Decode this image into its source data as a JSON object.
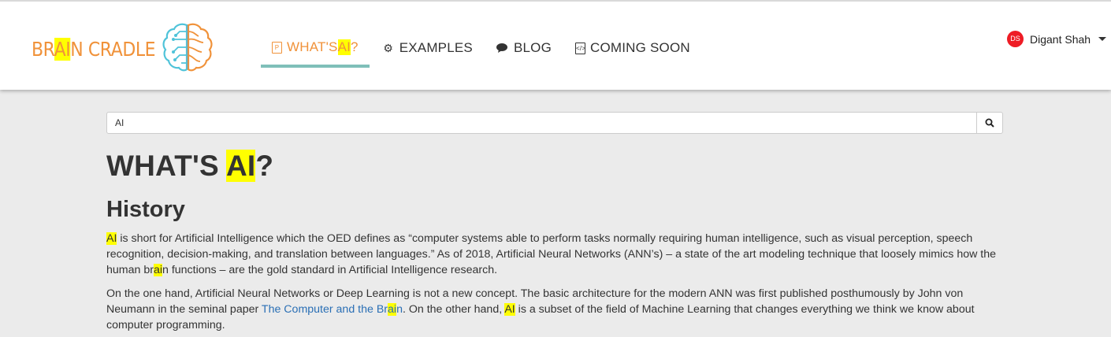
{
  "brand": {
    "part1": "BR",
    "highlight": "AI",
    "part2": "N CRADLE"
  },
  "nav": {
    "items": [
      {
        "pre": "WHAT'S ",
        "hl": "AI",
        "post": "?",
        "icon": "document-icon"
      },
      {
        "label": "EXAMPLES",
        "icon": "cogs-icon"
      },
      {
        "label": "BLOG",
        "icon": "comments-icon"
      },
      {
        "label": "COMING SOON",
        "icon": "code-file-icon"
      }
    ]
  },
  "user": {
    "initials": "DS",
    "name": "Digant Shah",
    "avatar_color": "#ee1c25"
  },
  "search": {
    "value": "AI",
    "icon": "search-icon"
  },
  "page": {
    "title_pre": "WHAT'S ",
    "title_hl": "AI",
    "title_post": "?",
    "section": "History"
  },
  "content": {
    "p1": {
      "hl1": "AI",
      "t1": " is short for Artificial Intelligence which the OED defines as “computer systems able to perform tasks normally requiring human intelligence, such as visual perception, speech recognition, decision-making, and translation between languages.” As of 2018, Artificial Neural Networks (ANN’s) – a state of the art modeling technique that loosely mimics how the human br",
      "hl2": "ai",
      "t2": "n functions – are the gold standard in Artificial Intelligence research."
    },
    "p2": {
      "t1": "On the one hand, Artificial Neural Networks or Deep Learning is not a new concept. The basic architecture for the modern ANN was first published posthumously by John von Neumann in the seminal paper ",
      "link_pre": "The Computer and the Br",
      "link_hl": "ai",
      "link_post": "n",
      "t2": ". On the other hand, ",
      "hl": "AI",
      "t3": " is a subset of the field of Machine Learning that changes everything we think we know about computer programming."
    }
  },
  "colors": {
    "brand_orange": "#f0923a",
    "highlight": "#ffff00",
    "active_underline": "#7fbfb9",
    "link": "#2a6fb5"
  }
}
